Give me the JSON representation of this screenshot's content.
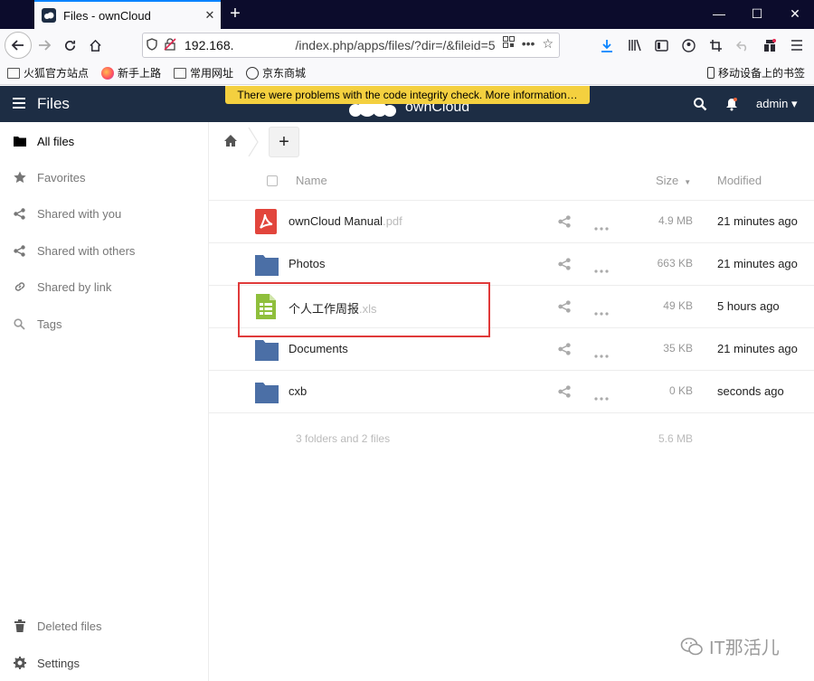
{
  "browser": {
    "tab_title": "Files - ownCloud",
    "tab_close": "✕",
    "new_tab": "+",
    "window_buttons": {
      "minimize": "—",
      "maximize": "☐",
      "close": "✕"
    },
    "url_host": "192.168.",
    "url_path": "/index.php/apps/files/?dir=/&fileid=5",
    "url_actions": [
      "•••",
      "☆"
    ],
    "bookmarks": [
      {
        "label": "火狐官方站点",
        "icon": "folder-icon"
      },
      {
        "label": "新手上路",
        "icon": "firefox-icon"
      },
      {
        "label": "常用网址",
        "icon": "folder-icon"
      },
      {
        "label": "京东商城",
        "icon": "globe-icon"
      }
    ],
    "mobile_bookmarks": "移动设备上的书签"
  },
  "header": {
    "app_title": "Files",
    "logo_text": "ownCloud",
    "warning": "There were problems with the code integrity check. More information…",
    "user": "admin ▾",
    "brand_color": "#1d2d44",
    "warning_color": "#f4d03f"
  },
  "sidebar": {
    "items": [
      {
        "label": "All files",
        "icon": "folder-icon",
        "active": true
      },
      {
        "label": "Favorites",
        "icon": "star-icon"
      },
      {
        "label": "Shared with you",
        "icon": "share-icon"
      },
      {
        "label": "Shared with others",
        "icon": "share-icon"
      },
      {
        "label": "Shared by link",
        "icon": "link-icon"
      },
      {
        "label": "Tags",
        "icon": "search-icon"
      }
    ],
    "bottom": [
      {
        "label": "Deleted files",
        "icon": "trash-icon"
      },
      {
        "label": "Settings",
        "icon": "gear-icon"
      }
    ]
  },
  "main": {
    "new_button": "+",
    "columns": {
      "name": "Name",
      "size": "Size",
      "sort_indicator": "▼",
      "modified": "Modified"
    },
    "files": [
      {
        "name": "ownCloud Manual",
        "ext": ".pdf",
        "type": "pdf",
        "size": "4.9 MB",
        "modified": "21 minutes ago"
      },
      {
        "name": "Photos",
        "ext": "",
        "type": "folder",
        "size": "663 KB",
        "modified": "21 minutes ago"
      },
      {
        "name": "个人工作周报",
        "ext": ".xls",
        "type": "spreadsheet",
        "size": "49 KB",
        "modified": "5 hours ago"
      },
      {
        "name": "Documents",
        "ext": "",
        "type": "folder",
        "size": "35 KB",
        "modified": "21 minutes ago"
      },
      {
        "name": "cxb",
        "ext": "",
        "type": "folder",
        "size": "0 KB",
        "modified": "seconds ago"
      }
    ],
    "summary": {
      "text": "3 folders and 2 files",
      "size": "5.6 MB"
    }
  },
  "watermark": "IT那活儿"
}
